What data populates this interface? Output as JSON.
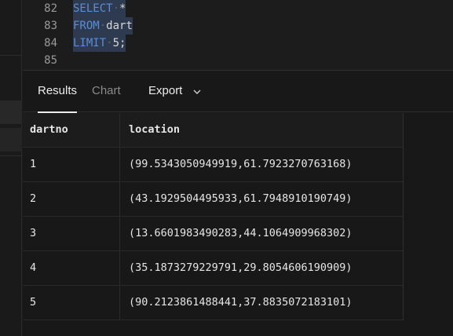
{
  "editor": {
    "lines": [
      {
        "number": "82",
        "tokens": [
          {
            "t": "SELECT",
            "k": "kw"
          },
          {
            "t": "*",
            "k": "id"
          }
        ],
        "selected": true
      },
      {
        "number": "83",
        "tokens": [
          {
            "t": "FROM",
            "k": "kw"
          },
          {
            "t": "dart",
            "k": "id"
          }
        ],
        "selected": true
      },
      {
        "number": "84",
        "tokens": [
          {
            "t": "LIMIT",
            "k": "kw"
          },
          {
            "t": "5;",
            "k": "id"
          }
        ],
        "selected": true
      },
      {
        "number": "85",
        "tokens": [],
        "selected": false
      }
    ]
  },
  "tabs": {
    "results": "Results",
    "chart": "Chart",
    "export": "Export"
  },
  "table": {
    "columns": [
      "dartno",
      "location"
    ],
    "rows": [
      [
        "1",
        "(99.5343050949919,61.7923270763168)"
      ],
      [
        "2",
        "(43.1929504495933,61.7948910190749)"
      ],
      [
        "3",
        "(13.6601983490283,44.1064909968302)"
      ],
      [
        "4",
        "(35.1873279229791,29.8054606190909)"
      ],
      [
        "5",
        "(90.2123861488441,37.8835072183101)"
      ]
    ]
  },
  "colors": {
    "keyword": "#5b8ed6",
    "selection": "#2d3a4f",
    "background": "#1c1c1c"
  }
}
